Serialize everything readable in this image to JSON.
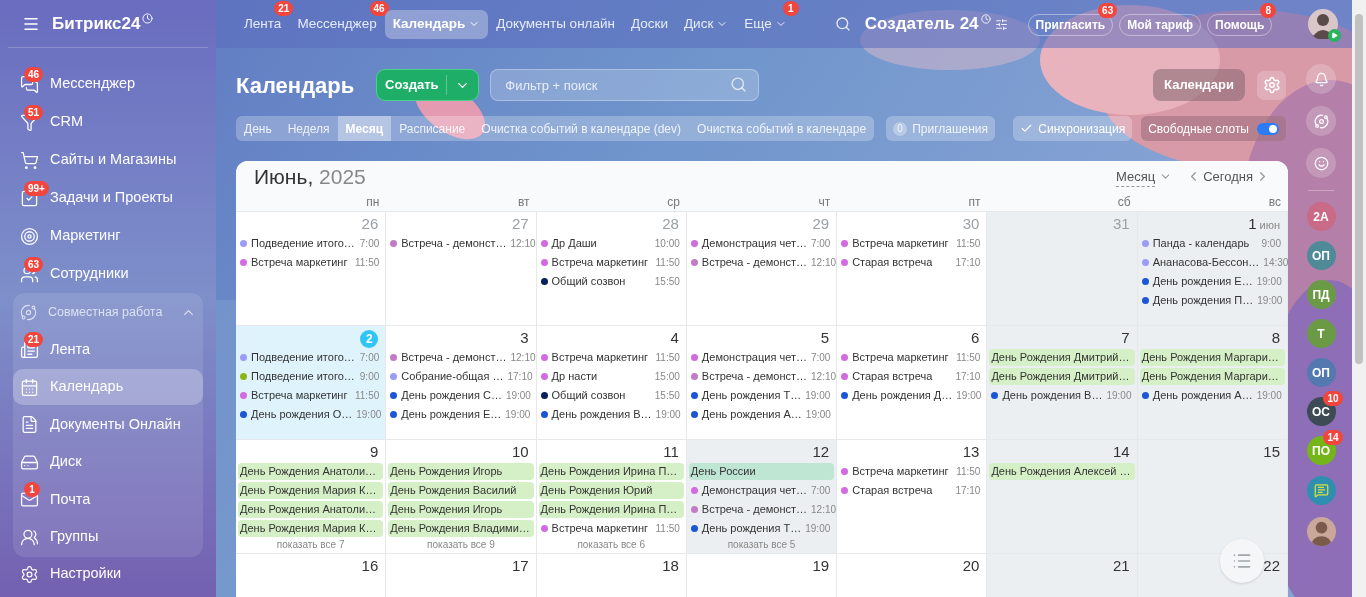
{
  "sidebar": {
    "logo": "Битрикс24",
    "items": [
      {
        "label": "Мессенджер",
        "badge": "46",
        "selected": false
      },
      {
        "label": "CRM",
        "badge": "51",
        "selected": false
      },
      {
        "label": "Сайты и Магазины",
        "selected": false
      },
      {
        "label": "Задачи и Проекты",
        "badge": "99+",
        "selected": false
      },
      {
        "label": "Маркетинг",
        "selected": false
      },
      {
        "label": "Сотрудники",
        "badge": "63",
        "selected": false
      }
    ],
    "group": {
      "label": "Совместная работа",
      "expanded": true,
      "items": [
        {
          "label": "Лента",
          "badge": "21",
          "selected": false
        },
        {
          "label": "Календарь",
          "selected": true
        },
        {
          "label": "Документы Онлайн",
          "selected": false
        },
        {
          "label": "Диск",
          "selected": false
        },
        {
          "label": "Почта",
          "badge": "1",
          "selected": false
        },
        {
          "label": "Группы",
          "selected": false
        }
      ]
    },
    "settings": "Настройки"
  },
  "nav": [
    {
      "label": "Лента",
      "badge": "21",
      "has_menu": false,
      "selected": false
    },
    {
      "label": "Мессенджер",
      "badge": "46",
      "has_menu": false,
      "selected": false
    },
    {
      "label": "Календарь",
      "has_menu": true,
      "selected": true
    },
    {
      "label": "Документы онлайн",
      "has_menu": false,
      "selected": false
    },
    {
      "label": "Доски",
      "has_menu": false,
      "selected": false
    },
    {
      "label": "Диск",
      "has_menu": true,
      "selected": false
    },
    {
      "label": "Еще",
      "badge": "1",
      "has_menu": true,
      "selected": false
    }
  ],
  "portal": {
    "name": "Создатель 24"
  },
  "top_buttons": [
    {
      "label": "Пригласить",
      "badge": "63"
    },
    {
      "label": "Мой тариф"
    },
    {
      "label": "Помощь",
      "badge": "8"
    }
  ],
  "header": {
    "title": "Календарь",
    "create": "Создать",
    "search_placeholder": "Фильтр + поиск",
    "calendars": "Календари"
  },
  "views": [
    {
      "label": "День",
      "selected": false
    },
    {
      "label": "Неделя",
      "selected": false
    },
    {
      "label": "Месяц",
      "selected": true
    },
    {
      "label": "Расписание",
      "selected": false
    },
    {
      "label": "Очистка событий в календаре (dev)",
      "selected": false
    },
    {
      "label": "Очистка событий в календаре",
      "selected": false
    }
  ],
  "invitations": {
    "count": "0",
    "label": "Приглашения"
  },
  "sync": {
    "label": "Синхронизация",
    "checked": true
  },
  "free_slots": {
    "label": "Свободные слоты",
    "on": true
  },
  "calendar": {
    "month": "Июнь,",
    "year": "2025",
    "view": "Месяц",
    "today": "Сегодня",
    "weekdays": [
      "пн",
      "вт",
      "ср",
      "чт",
      "пт",
      "сб",
      "вс"
    ],
    "weeks": [
      [
        {
          "day": "26",
          "muted": true,
          "dayoff": false,
          "today": false,
          "events": [
            {
              "kind": "timed",
              "title": "Подведение итого…",
              "time": "7:00",
              "color": "#9b9cf5"
            },
            {
              "kind": "timed",
              "title": "Встреча маркетинг",
              "time": "11:50",
              "color": "#d26be0"
            }
          ]
        },
        {
          "day": "27",
          "muted": true,
          "dayoff": false,
          "today": false,
          "events": [
            {
              "kind": "timed",
              "title": "Встреча - демонст…",
              "time": "12:10",
              "color": "#c27bc5"
            }
          ]
        },
        {
          "day": "28",
          "muted": true,
          "dayoff": false,
          "today": false,
          "events": [
            {
              "kind": "timed",
              "title": "Др Даши",
              "time": "10:00",
              "color": "#d26be0"
            },
            {
              "kind": "timed",
              "title": "Встреча маркетинг",
              "time": "11:50",
              "color": "#d26be0"
            },
            {
              "kind": "timed",
              "title": "Общий созвон",
              "time": "15:50",
              "color": "#0b1f5c"
            }
          ]
        },
        {
          "day": "29",
          "muted": true,
          "dayoff": false,
          "today": false,
          "events": [
            {
              "kind": "timed",
              "title": "Демонстрация чет…",
              "time": "7:00",
              "color": "#d26be0"
            },
            {
              "kind": "timed",
              "title": "Встреча - демонст…",
              "time": "12:10",
              "color": "#c27bc5"
            }
          ]
        },
        {
          "day": "30",
          "muted": true,
          "dayoff": false,
          "today": false,
          "events": [
            {
              "kind": "timed",
              "title": "Встреча маркетинг",
              "time": "11:50",
              "color": "#d26be0"
            },
            {
              "kind": "timed",
              "title": "Старая встреча",
              "time": "17:10",
              "color": "#d26be0"
            }
          ]
        },
        {
          "day": "31",
          "muted": true,
          "dayoff": true,
          "today": false
        },
        {
          "day": "1",
          "month_label": "июн",
          "muted": false,
          "dayoff": true,
          "today": false,
          "events": [
            {
              "kind": "timed",
              "title": "Панда - календарь",
              "time": "9:00",
              "color": "#9b9cf5"
            },
            {
              "kind": "timed",
              "title": "Ананасова-Бессон…",
              "time": "14:30",
              "color": "#9b9cf5"
            },
            {
              "kind": "timed",
              "title": "День рождения Е…",
              "time": "19:00",
              "color": "#1a56d6"
            },
            {
              "kind": "timed",
              "title": "День рождения П…",
              "time": "19:00",
              "color": "#1a56d6"
            }
          ]
        }
      ],
      [
        {
          "day": "2",
          "muted": false,
          "dayoff": false,
          "today": true,
          "events": [
            {
              "kind": "timed",
              "title": "Подведение итого…",
              "time": "7:00",
              "color": "#9b9cf5"
            },
            {
              "kind": "timed",
              "title": "Подведение итого…",
              "time": "9:00",
              "color": "#8bb514"
            },
            {
              "kind": "timed",
              "title": "Встреча маркетинг",
              "time": "11:50",
              "color": "#d26be0"
            },
            {
              "kind": "timed",
              "title": "День рождения О…",
              "time": "19:00",
              "color": "#1a56d6"
            }
          ]
        },
        {
          "day": "3",
          "muted": false,
          "dayoff": false,
          "today": false,
          "events": [
            {
              "kind": "timed",
              "title": "Встреча - демонст…",
              "time": "12:10",
              "color": "#c27bc5"
            },
            {
              "kind": "timed",
              "title": "Собрание-общая …",
              "time": "17:10",
              "color": "#9b9cf5"
            },
            {
              "kind": "timed",
              "title": "День рождения С…",
              "time": "19:00",
              "color": "#1a56d6"
            },
            {
              "kind": "timed",
              "title": "День рождения Е…",
              "time": "19:00",
              "color": "#1a56d6"
            }
          ]
        },
        {
          "day": "4",
          "muted": false,
          "dayoff": false,
          "today": false,
          "events": [
            {
              "kind": "timed",
              "title": "Встреча маркетинг",
              "time": "11:50",
              "color": "#d26be0"
            },
            {
              "kind": "timed",
              "title": "Др насти",
              "time": "15:00",
              "color": "#d26be0"
            },
            {
              "kind": "timed",
              "title": "Общий созвон",
              "time": "15:50",
              "color": "#0b1f5c"
            },
            {
              "kind": "timed",
              "title": "День рождения В…",
              "time": "19:00",
              "color": "#1a56d6"
            }
          ]
        },
        {
          "day": "5",
          "muted": false,
          "dayoff": false,
          "today": false,
          "events": [
            {
              "kind": "timed",
              "title": "Демонстрация чет…",
              "time": "7:00",
              "color": "#d26be0"
            },
            {
              "kind": "timed",
              "title": "Встреча - демонст…",
              "time": "12:10",
              "color": "#c27bc5"
            },
            {
              "kind": "timed",
              "title": "День рождения Т…",
              "time": "19:00",
              "color": "#1a56d6"
            },
            {
              "kind": "timed",
              "title": "День рождения А…",
              "time": "19:00",
              "color": "#1a56d6"
            }
          ]
        },
        {
          "day": "6",
          "muted": false,
          "dayoff": false,
          "today": false,
          "events": [
            {
              "kind": "timed",
              "title": "Встреча маркетинг",
              "time": "11:50",
              "color": "#d26be0"
            },
            {
              "kind": "timed",
              "title": "Старая встреча",
              "time": "17:10",
              "color": "#d26be0"
            },
            {
              "kind": "timed",
              "title": "День рождения Д…",
              "time": "19:00",
              "color": "#1a56d6"
            }
          ]
        },
        {
          "day": "7",
          "muted": false,
          "dayoff": true,
          "today": false,
          "events": [
            {
              "kind": "allday",
              "title": "День Рождения Дмитрий…",
              "color": "#d5f0c6"
            },
            {
              "kind": "allday",
              "title": "День Рождения Дмитрий…",
              "color": "#d5f0c6"
            },
            {
              "kind": "timed",
              "title": "День рождения В…",
              "time": "19:00",
              "color": "#1a56d6"
            }
          ]
        },
        {
          "day": "8",
          "muted": false,
          "dayoff": true,
          "today": false,
          "events": [
            {
              "kind": "allday",
              "title": "День Рождения Маргари…",
              "color": "#d5f0c6"
            },
            {
              "kind": "allday",
              "title": "День Рождения Маргари…",
              "color": "#d5f0c6"
            },
            {
              "kind": "timed",
              "title": "День рождения А…",
              "time": "19:00",
              "color": "#1a56d6"
            }
          ]
        }
      ],
      [
        {
          "day": "9",
          "muted": false,
          "dayoff": false,
          "today": false,
          "more": "показать все 7",
          "events": [
            {
              "kind": "allday",
              "title": "День Рождения Анатоли…",
              "color": "#d5f0c6"
            },
            {
              "kind": "allday",
              "title": "День Рождения Мария К…",
              "color": "#d5f0c6"
            },
            {
              "kind": "allday",
              "title": "День Рождения Анатоли…",
              "color": "#d5f0c6"
            },
            {
              "kind": "allday",
              "title": "День Рождения Мария К…",
              "color": "#d5f0c6"
            }
          ]
        },
        {
          "day": "10",
          "muted": false,
          "dayoff": false,
          "today": false,
          "more": "показать все 9",
          "events": [
            {
              "kind": "allday",
              "title": "День Рождения Игорь",
              "color": "#d5f0c6"
            },
            {
              "kind": "allday",
              "title": "День Рождения Василий",
              "color": "#d5f0c6"
            },
            {
              "kind": "allday",
              "title": "День Рождения Игорь",
              "color": "#d5f0c6"
            },
            {
              "kind": "allday",
              "title": "День Рождения Владими…",
              "color": "#d5f0c6"
            }
          ]
        },
        {
          "day": "11",
          "muted": false,
          "dayoff": false,
          "today": false,
          "more": "показать все 6",
          "events": [
            {
              "kind": "allday",
              "title": "День Рождения Ирина П…",
              "color": "#d5f0c6"
            },
            {
              "kind": "allday",
              "title": "День Рождения Юрий",
              "color": "#d5f0c6"
            },
            {
              "kind": "allday",
              "title": "День Рождения Ирина П…",
              "color": "#d5f0c6"
            },
            {
              "kind": "timed",
              "title": "Встреча маркетинг",
              "time": "11:50",
              "color": "#d26be0"
            }
          ]
        },
        {
          "day": "12",
          "muted": false,
          "dayoff": true,
          "today": false,
          "more": "показать все 5",
          "events": [
            {
              "kind": "allday",
              "title": "День России",
              "color": "#bfe5d3"
            },
            {
              "kind": "timed",
              "title": "Демонстрация чет…",
              "time": "7:00",
              "color": "#d26be0"
            },
            {
              "kind": "timed",
              "title": "Встреча - демонст…",
              "time": "12:10",
              "color": "#c27bc5"
            },
            {
              "kind": "timed",
              "title": "День рождения Т…",
              "time": "19:00",
              "color": "#1a56d6"
            }
          ]
        },
        {
          "day": "13",
          "muted": false,
          "dayoff": false,
          "today": false,
          "events": [
            {
              "kind": "timed",
              "title": "Встреча маркетинг",
              "time": "11:50",
              "color": "#d26be0"
            },
            {
              "kind": "timed",
              "title": "Старая встреча",
              "time": "17:10",
              "color": "#d26be0"
            }
          ]
        },
        {
          "day": "14",
          "muted": false,
          "dayoff": true,
          "today": false,
          "events": [
            {
              "kind": "allday",
              "title": "День Рождения Алексей …",
              "color": "#d5f0c6"
            }
          ]
        },
        {
          "day": "15",
          "muted": false,
          "dayoff": true,
          "today": false
        }
      ],
      [
        {
          "day": "16",
          "muted": false,
          "dayoff": false,
          "today": false
        },
        {
          "day": "17",
          "muted": false,
          "dayoff": false,
          "today": false
        },
        {
          "day": "18",
          "muted": false,
          "dayoff": false,
          "today": false
        },
        {
          "day": "19",
          "muted": false,
          "dayoff": false,
          "today": false
        },
        {
          "day": "20",
          "muted": false,
          "dayoff": false,
          "today": false
        },
        {
          "day": "21",
          "muted": false,
          "dayoff": true,
          "today": false
        },
        {
          "day": "22",
          "muted": false,
          "dayoff": true,
          "today": false
        }
      ]
    ]
  },
  "rail": {
    "avatars": [
      {
        "initials": "2А",
        "color": "#c96a86"
      },
      {
        "initials": "ОП",
        "color": "#4f8a99"
      },
      {
        "initials": "ПД",
        "color": "#6b9a45"
      },
      {
        "initials": "Т",
        "color": "#6b9a45"
      },
      {
        "initials": "ОП",
        "color": "#5479b0"
      },
      {
        "initials": "ОС",
        "color": "#3d4b55",
        "badge": "10"
      },
      {
        "initials": "ПО",
        "color": "#74b51a",
        "badge": "14"
      }
    ]
  }
}
